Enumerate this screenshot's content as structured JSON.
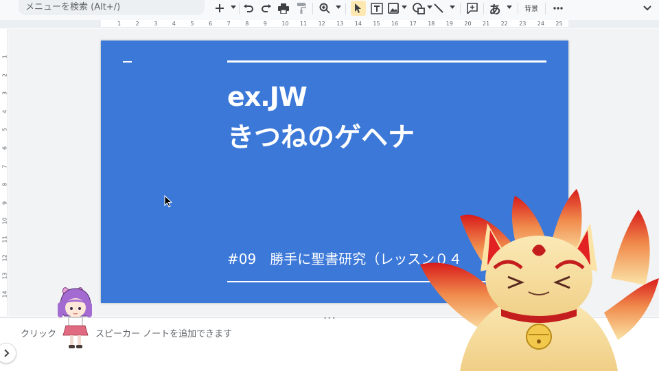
{
  "toolbar": {
    "search_placeholder": "メニューを検索 (Alt+/)",
    "background_label": "背景",
    "text_style_label": "あ"
  },
  "ruler": {
    "h_ticks": [
      "1",
      "2",
      "3",
      "4",
      "5",
      "6",
      "7",
      "8",
      "9",
      "10",
      "11",
      "12",
      "13",
      "14",
      "15",
      "16",
      "17",
      "18",
      "19",
      "20",
      "21",
      "22",
      "23",
      "24",
      "25"
    ],
    "v_ticks": [
      "1",
      "2",
      "3",
      "4",
      "5",
      "6",
      "7",
      "8",
      "9",
      "10",
      "11",
      "12",
      "13",
      "14"
    ]
  },
  "slide": {
    "title_line1": "ex.JW",
    "title_line2": "きつねのゲヘナ",
    "subtitle": "#09　勝手に聖書研究（レッスン０４"
  },
  "notes": {
    "placeholder_left": "クリック",
    "placeholder_right": "スピーカー ノートを追加できます"
  },
  "colors": {
    "slide_background": "#3c78d8",
    "toolbar_active": "#fde8b2",
    "canvas": "#f1f3f4"
  }
}
